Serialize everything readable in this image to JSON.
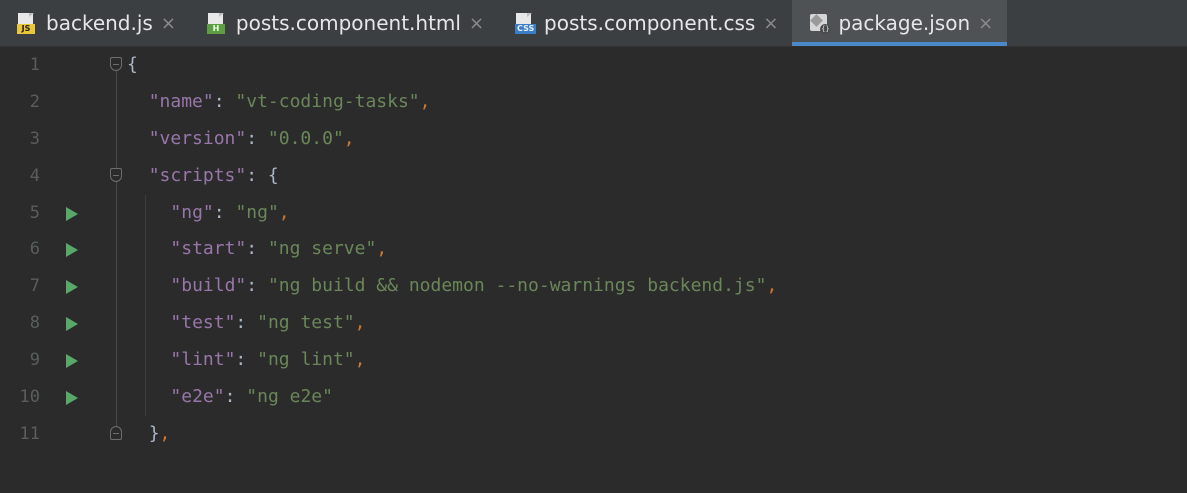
{
  "tabs": [
    {
      "name": "backend.js",
      "icon": "js-file-icon",
      "badge": "JS",
      "kind": "js",
      "active": false
    },
    {
      "name": "posts.component.html",
      "icon": "html-file-icon",
      "badge": "H",
      "kind": "html",
      "active": false
    },
    {
      "name": "posts.component.css",
      "icon": "css-file-icon",
      "badge": "CSS",
      "kind": "css",
      "active": false
    },
    {
      "name": "package.json",
      "icon": "json-file-icon",
      "badge": "{}",
      "kind": "json",
      "active": true
    }
  ],
  "tab_close_glyph": "×",
  "code": {
    "lines": [
      {
        "n": "1",
        "indent": 0,
        "tokens": [
          {
            "t": "{",
            "c": "b"
          }
        ]
      },
      {
        "n": "2",
        "indent": 2,
        "tokens": [
          {
            "t": "\"name\"",
            "c": "k"
          },
          {
            "t": ": ",
            "c": "b"
          },
          {
            "t": "\"vt-coding-tasks\"",
            "c": "s"
          },
          {
            "t": ",",
            "c": "p"
          }
        ]
      },
      {
        "n": "3",
        "indent": 2,
        "tokens": [
          {
            "t": "\"version\"",
            "c": "k"
          },
          {
            "t": ": ",
            "c": "b"
          },
          {
            "t": "\"0.0.0\"",
            "c": "s"
          },
          {
            "t": ",",
            "c": "p"
          }
        ]
      },
      {
        "n": "4",
        "indent": 2,
        "tokens": [
          {
            "t": "\"scripts\"",
            "c": "k"
          },
          {
            "t": ": {",
            "c": "b"
          }
        ]
      },
      {
        "n": "5",
        "indent": 4,
        "run": true,
        "tokens": [
          {
            "t": "\"ng\"",
            "c": "k"
          },
          {
            "t": ": ",
            "c": "b"
          },
          {
            "t": "\"ng\"",
            "c": "s"
          },
          {
            "t": ",",
            "c": "p"
          }
        ]
      },
      {
        "n": "6",
        "indent": 4,
        "run": true,
        "tokens": [
          {
            "t": "\"start\"",
            "c": "k"
          },
          {
            "t": ": ",
            "c": "b"
          },
          {
            "t": "\"ng serve\"",
            "c": "s"
          },
          {
            "t": ",",
            "c": "p"
          }
        ]
      },
      {
        "n": "7",
        "indent": 4,
        "run": true,
        "tokens": [
          {
            "t": "\"build\"",
            "c": "k"
          },
          {
            "t": ": ",
            "c": "b"
          },
          {
            "t": "\"ng build && nodemon --no-warnings backend.js\"",
            "c": "s"
          },
          {
            "t": ",",
            "c": "p"
          }
        ]
      },
      {
        "n": "8",
        "indent": 4,
        "run": true,
        "tokens": [
          {
            "t": "\"test\"",
            "c": "k"
          },
          {
            "t": ": ",
            "c": "b"
          },
          {
            "t": "\"ng test\"",
            "c": "s"
          },
          {
            "t": ",",
            "c": "p"
          }
        ]
      },
      {
        "n": "9",
        "indent": 4,
        "run": true,
        "tokens": [
          {
            "t": "\"lint\"",
            "c": "k"
          },
          {
            "t": ": ",
            "c": "b"
          },
          {
            "t": "\"ng lint\"",
            "c": "s"
          },
          {
            "t": ",",
            "c": "p"
          }
        ]
      },
      {
        "n": "10",
        "indent": 4,
        "run": true,
        "tokens": [
          {
            "t": "\"e2e\"",
            "c": "k"
          },
          {
            "t": ": ",
            "c": "b"
          },
          {
            "t": "\"ng e2e\"",
            "c": "s"
          }
        ]
      },
      {
        "n": "11",
        "indent": 2,
        "tokens": [
          {
            "t": "}",
            "c": "b"
          },
          {
            "t": ",",
            "c": "p"
          }
        ]
      }
    ]
  },
  "colors": {
    "background": "#2b2b2b",
    "tabbar": "#3c3f41",
    "active_tab_underline": "#4a88c7",
    "json_key": "#9876aa",
    "json_string": "#6a8759",
    "punctuation": "#cc7832",
    "line_number": "#5a5d5f",
    "run_marker": "#59a869"
  }
}
